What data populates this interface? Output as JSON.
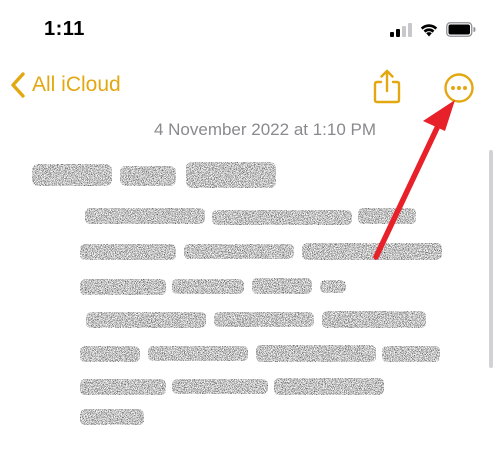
{
  "status_bar": {
    "time": "1:11"
  },
  "nav": {
    "back_label": "All iCloud"
  },
  "note": {
    "date": "4 November 2022 at 1:10 PM"
  },
  "icons": {
    "back": "chevron-left-icon",
    "share": "share-icon",
    "more": "ellipsis-circle-icon",
    "signal": "cellular-signal-icon",
    "wifi": "wifi-icon",
    "battery": "battery-icon"
  },
  "colors": {
    "accent": "#e3a811",
    "date_text": "#8a8a8e",
    "annotation_arrow": "#e8202a"
  }
}
